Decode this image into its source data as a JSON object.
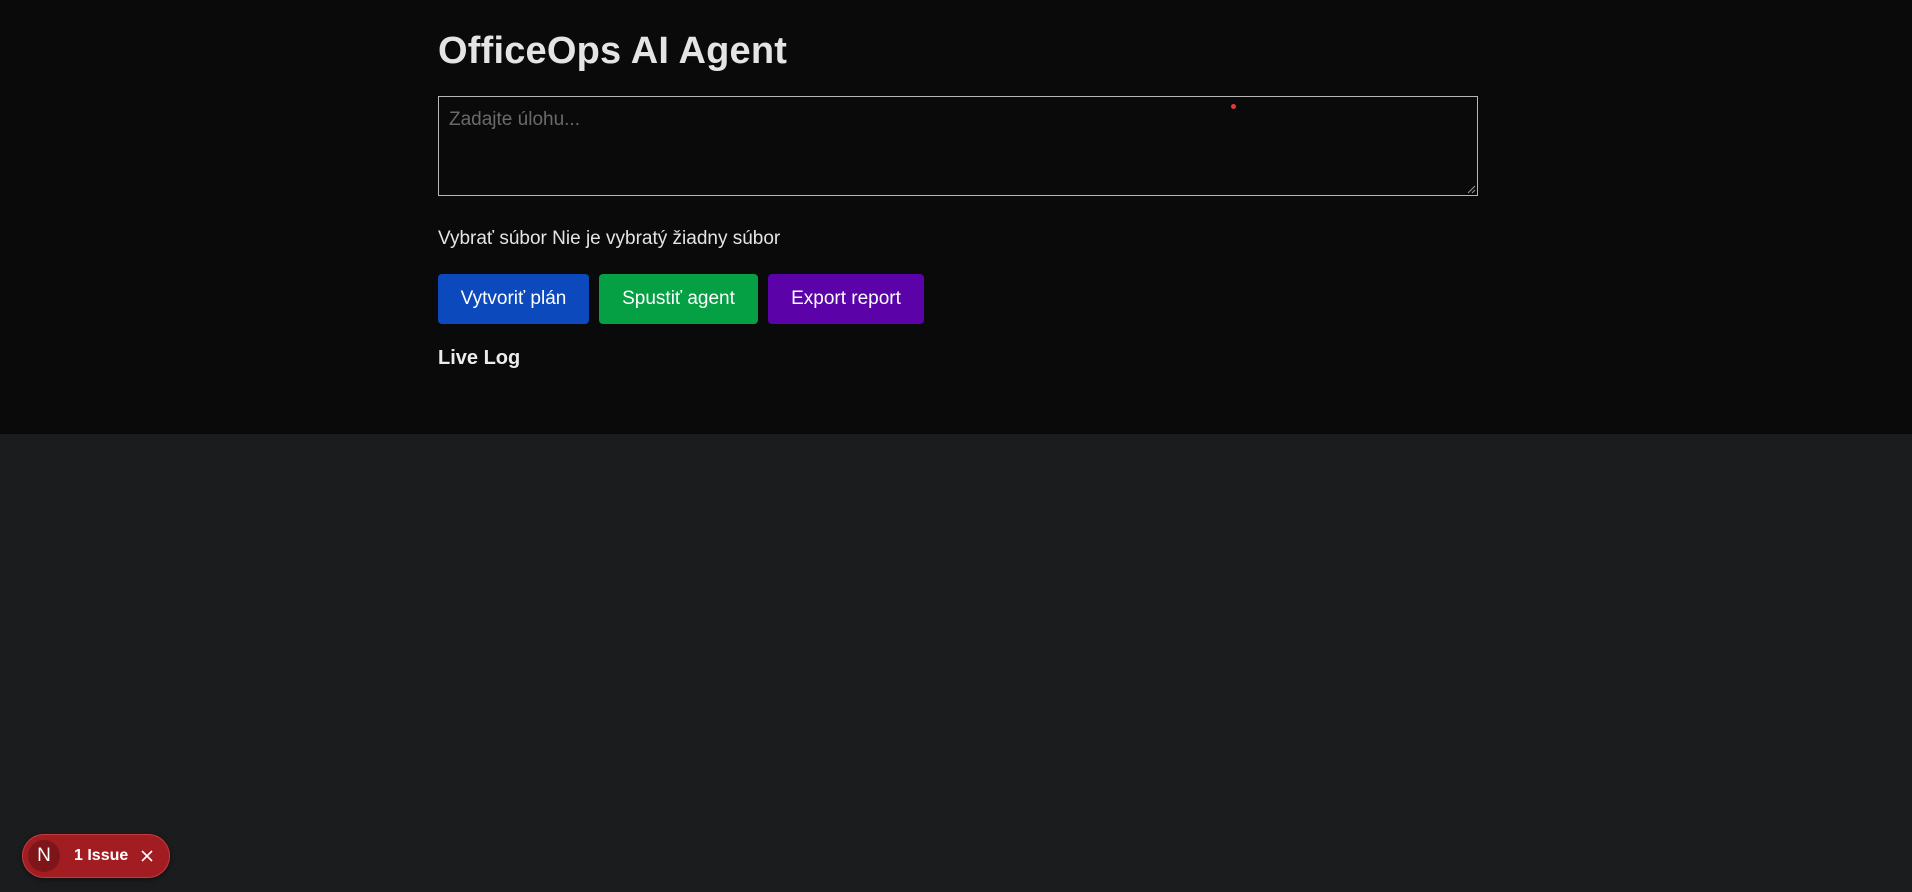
{
  "app": {
    "title": "OfficeOps AI Agent"
  },
  "task": {
    "value": "",
    "placeholder": "Zadajte úlohu..."
  },
  "file_input": {
    "button_label": "Vybrať súbor",
    "status": "Nie je vybratý žiadny súbor"
  },
  "actions": {
    "plan_label": "Vytvoriť plán",
    "run_label": "Spustiť agent",
    "export_label": "Export report"
  },
  "log": {
    "heading": "Live Log"
  },
  "dev_overlay": {
    "logo_letter": "N",
    "issues_label": "1 Issue",
    "icons": {
      "logo": "nextjs-logo-icon",
      "close": "close-icon"
    }
  },
  "colors": {
    "page_bg": "#1b1c1e",
    "panel_bg": "#0a0a0b",
    "plan_button": "#0b49bd",
    "run_button": "#04a043",
    "export_button": "#5b02a9",
    "issue_badge": "#a11d22"
  }
}
